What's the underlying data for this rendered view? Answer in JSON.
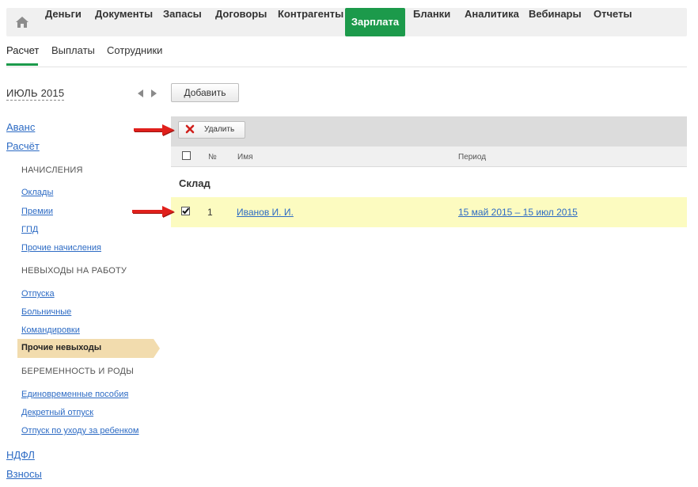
{
  "nav": {
    "home_icon": "house-icon",
    "items": [
      {
        "label": "Деньги"
      },
      {
        "label": "Документы"
      },
      {
        "label": "Запасы"
      },
      {
        "label": "Договоры"
      },
      {
        "label": "Контрагенты"
      },
      {
        "label": "Зарплата",
        "active": true
      },
      {
        "label": "Бланки"
      },
      {
        "label": "Аналитика"
      },
      {
        "label": "Вебинары"
      },
      {
        "label": "Отчеты"
      }
    ],
    "accent_color": "#1c9a4b"
  },
  "subtabs": [
    {
      "label": "Расчет",
      "active": true
    },
    {
      "label": "Выплаты"
    },
    {
      "label": "Сотрудники"
    }
  ],
  "sidebar": {
    "month": "ИЮЛЬ 2015",
    "links_top": [
      {
        "label": "Аванс"
      },
      {
        "label": "Расчёт"
      }
    ],
    "sections": [
      {
        "heading": "НАЧИСЛЕНИЯ",
        "items": [
          {
            "label": "Оклады"
          },
          {
            "label": "Премии"
          },
          {
            "label": "ГПД"
          },
          {
            "label": "Прочие начисления"
          }
        ]
      },
      {
        "heading": "НЕВЫХОДЫ НА РАБОТУ",
        "items": [
          {
            "label": "Отпуска"
          },
          {
            "label": "Больничные"
          },
          {
            "label": "Командировки"
          },
          {
            "label": "Прочие невыходы",
            "active": true
          }
        ]
      },
      {
        "heading": "БЕРЕМЕННОСТЬ И РОДЫ",
        "items": [
          {
            "label": "Единовременные пособия"
          },
          {
            "label": "Декретный отпуск"
          },
          {
            "label": "Отпуск по уходу за ребенком"
          }
        ]
      }
    ],
    "links_bottom": [
      {
        "label": "НДФЛ"
      },
      {
        "label": "Взносы"
      }
    ],
    "active_bg": "#f2dcae"
  },
  "main": {
    "add_button": "Добавить",
    "delete_button": "Удалить",
    "columns": [
      "№",
      "Имя",
      "Период"
    ],
    "group": "Склад",
    "rows": [
      {
        "checked": true,
        "num": "1",
        "name": "Иванов И. И.",
        "period": "15 май 2015 – 15 июл 2015"
      }
    ],
    "row_highlight": "#fcfbc0",
    "annotation_color": "#e0201c"
  }
}
